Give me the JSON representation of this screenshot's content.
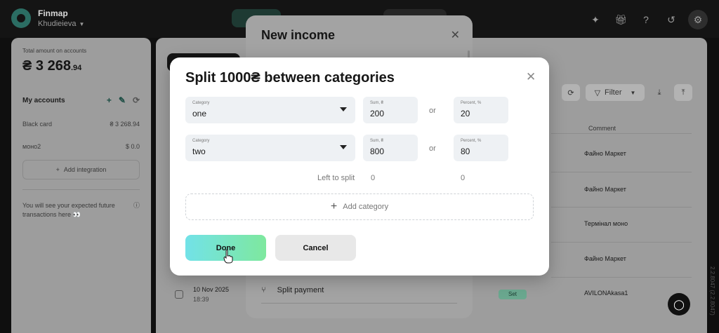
{
  "app": {
    "brand": "Finmap",
    "workspace": "Khudieieva",
    "version": "2.2.8047 (2.2.8047)"
  },
  "sidebar": {
    "total_label": "Total amount on accounts",
    "total_main": "₴ 3 268",
    "total_cents": ".94",
    "accounts_title": "My accounts",
    "accounts": [
      {
        "name": "Black card",
        "amount": "₴ 3 268.94"
      },
      {
        "name": "моно2",
        "amount": "$ 0.0"
      }
    ],
    "add_integration": "Add integration",
    "future_text": "You will see your expected future transactions here 👀"
  },
  "table": {
    "filter_label": "Filter",
    "comment_header": "Comment",
    "comments": [
      "Файно Маркет",
      "Файно Маркет",
      "Термінал моно",
      "Файно Маркет",
      "AVILONAkasa1"
    ],
    "row_date": "10 Nov 2025",
    "row_time": "18:39",
    "row_badge": "Set"
  },
  "drawer": {
    "title": "New income",
    "split_payment": "Split payment"
  },
  "modal": {
    "title": "Split 1000₴ between categories",
    "rows": [
      {
        "category_label": "Category",
        "category": "one",
        "sum_label": "Sum, ₴",
        "sum": "200",
        "or": "or",
        "percent_label": "Percent, %",
        "percent": "20"
      },
      {
        "category_label": "Category",
        "category": "two",
        "sum_label": "Sum, ₴",
        "sum": "800",
        "or": "or",
        "percent_label": "Percent, %",
        "percent": "80"
      }
    ],
    "left_to_split_label": "Left to split",
    "left_sum": "0",
    "left_percent": "0",
    "add_category": "Add category",
    "done": "Done",
    "cancel": "Cancel"
  },
  "colors": {
    "done_gradient_start": "#72e2e8",
    "done_gradient_end": "#7ee89e",
    "field_bg": "#eef1f4",
    "overlay_bg": "#9d9d9d"
  }
}
